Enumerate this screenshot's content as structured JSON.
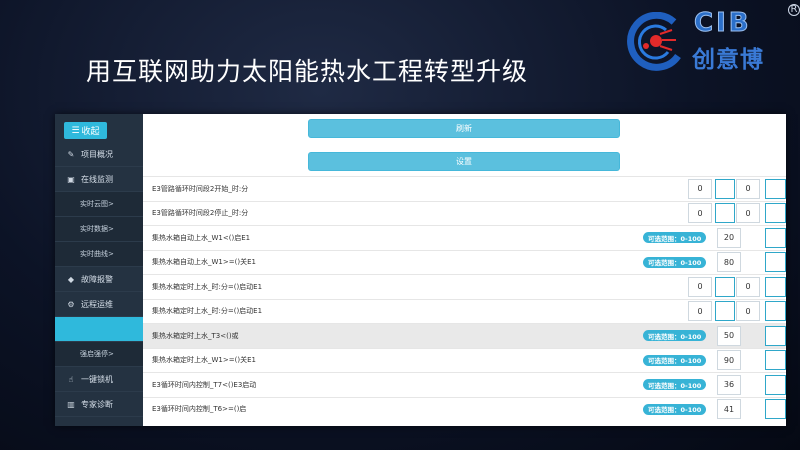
{
  "slide": {
    "title": "用互联网助力太阳能热水工程转型升级"
  },
  "logo": {
    "mark_text": "CIB",
    "cn_name": "创意博",
    "reg": "R"
  },
  "sidebar": {
    "collapse_label": "收起",
    "items": [
      {
        "label": "项目概况",
        "icon": "edit-icon",
        "sub": false
      },
      {
        "label": "在线监测",
        "icon": "image-icon",
        "sub": false
      },
      {
        "label": "实时云图>",
        "sub": true
      },
      {
        "label": "实时数据>",
        "sub": true
      },
      {
        "label": "实时曲线>",
        "sub": true
      },
      {
        "label": "故障报警",
        "icon": "diamond-icon",
        "sub": false
      },
      {
        "label": "远程运维",
        "icon": "gears-icon",
        "sub": false
      },
      {
        "label": "",
        "sub": true,
        "active": true
      },
      {
        "label": "强启强停>",
        "sub": true
      },
      {
        "label": "一键锁机",
        "icon": "hand-icon",
        "sub": false
      },
      {
        "label": "专家诊断",
        "icon": "chart-icon",
        "sub": false
      }
    ]
  },
  "main": {
    "refresh_label": "刷新",
    "settings_label": "设置",
    "rows": [
      {
        "label": "E3管路循环时间段2开始_时:分",
        "type": "time",
        "v1": "0",
        "v2": "0"
      },
      {
        "label": "E3管路循环时间段2停止_时:分",
        "type": "time",
        "v1": "0",
        "v2": "0"
      },
      {
        "label": "集热水箱自动上水_W1<()启E1",
        "type": "range",
        "range": "可选范围：0-100",
        "v1": "20"
      },
      {
        "label": "集热水箱自动上水_W1>=()关E1",
        "type": "range",
        "range": "可选范围：0-100",
        "v1": "80"
      },
      {
        "label": "集热水箱定时上水_时:分=()启动E1",
        "type": "time",
        "v1": "0",
        "v2": "0"
      },
      {
        "label": "集热水箱定时上水_时:分=()启动E1",
        "type": "time",
        "v1": "0",
        "v2": "0"
      },
      {
        "label": "集热水箱定时上水_T3<()或",
        "type": "range",
        "range": "可选范围：0-100",
        "v1": "50",
        "hl": true
      },
      {
        "label": "集热水箱定时上水_W1>=()关E1",
        "type": "range",
        "range": "可选范围：0-100",
        "v1": "90"
      },
      {
        "label": "E3循环时间内控制_T7<()E3启动",
        "type": "range",
        "range": "可选范围：0-100",
        "v1": "36"
      },
      {
        "label": "E3循环时间内控制_T6>=()启",
        "type": "range",
        "range": "可选范围：0-100",
        "v1": "41"
      }
    ]
  },
  "colors": {
    "accent": "#2fb9dc",
    "button": "#5bc0de",
    "sidebar": "#243241"
  }
}
